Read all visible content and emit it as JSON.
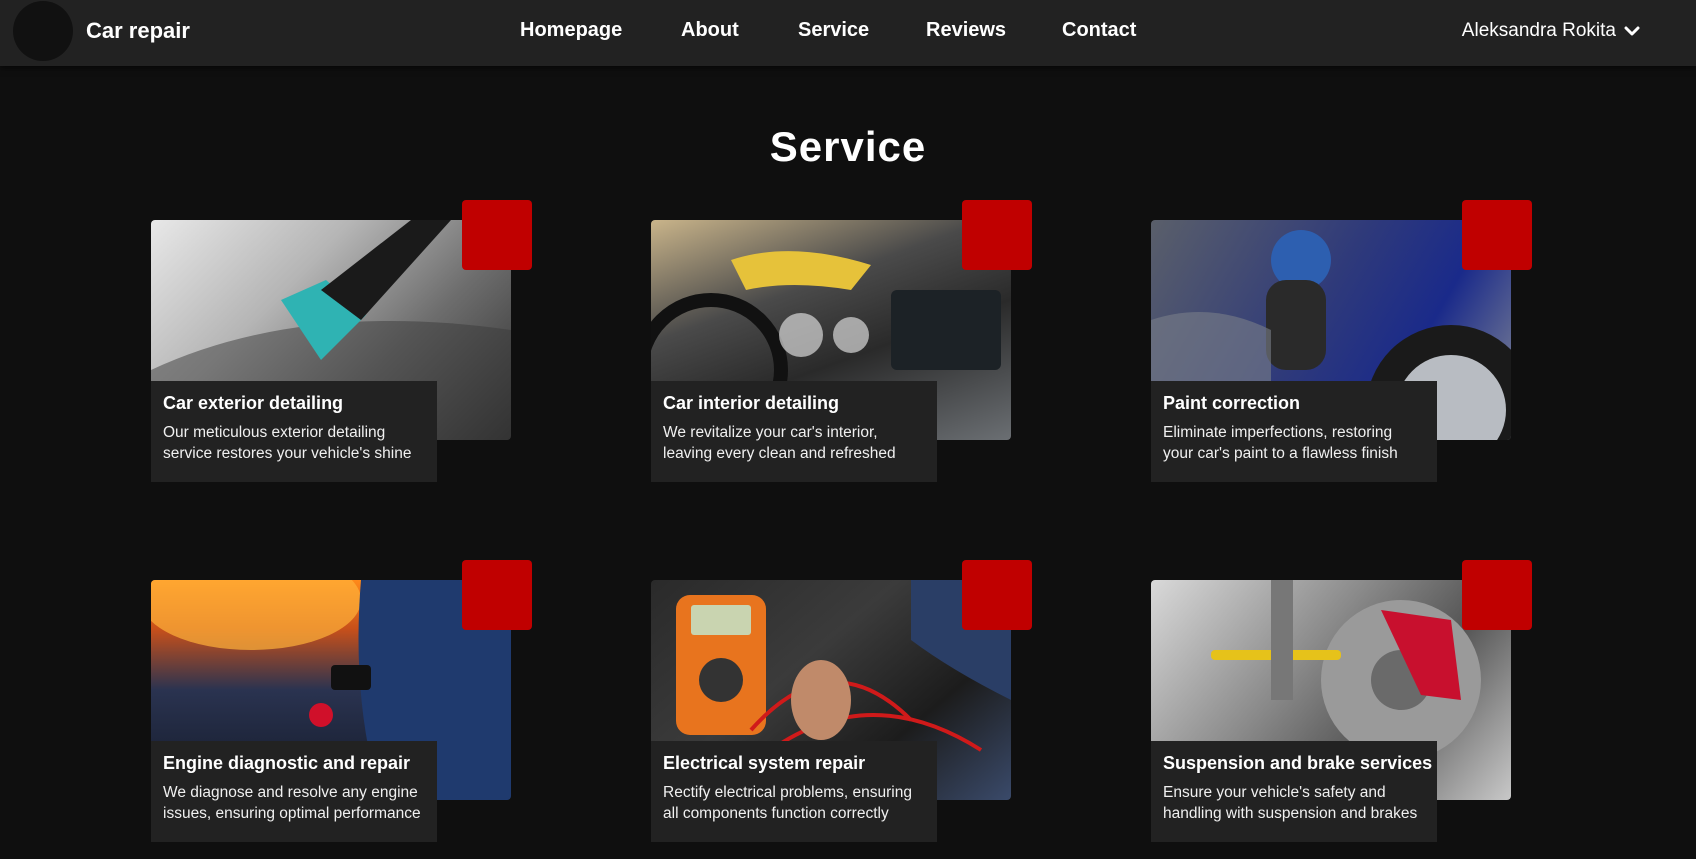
{
  "nav": {
    "brand": "Car repair",
    "links": [
      "Homepage",
      "About",
      "Service",
      "Reviews",
      "Contact"
    ],
    "user": "Aleksandra Rokita"
  },
  "page": {
    "title": "Service"
  },
  "services": [
    {
      "title": "Car exterior detailing",
      "description": "Our meticulous exterior detailing service restores your vehicle's shine"
    },
    {
      "title": "Car interior detailing",
      "description": "We revitalize your car's interior, leaving every clean and refreshed"
    },
    {
      "title": "Paint correction",
      "description": "Eliminate imperfections, restoring your car's paint to a flawless finish"
    },
    {
      "title": "Engine diagnostic and repair",
      "description": "We diagnose and resolve any engine issues, ensuring optimal performance"
    },
    {
      "title": "Electrical system repair",
      "description": "Rectify electrical problems, ensuring all components function correctly"
    },
    {
      "title": "Suspension and brake services",
      "description": "Ensure your vehicle's safety and handling with suspension and brakes"
    }
  ],
  "colors": {
    "navbar": "#222222",
    "background": "#0f0f0f",
    "accent": "#c00000",
    "caption": "#222222"
  },
  "icons": {
    "user_menu": "chevron-down-icon"
  }
}
